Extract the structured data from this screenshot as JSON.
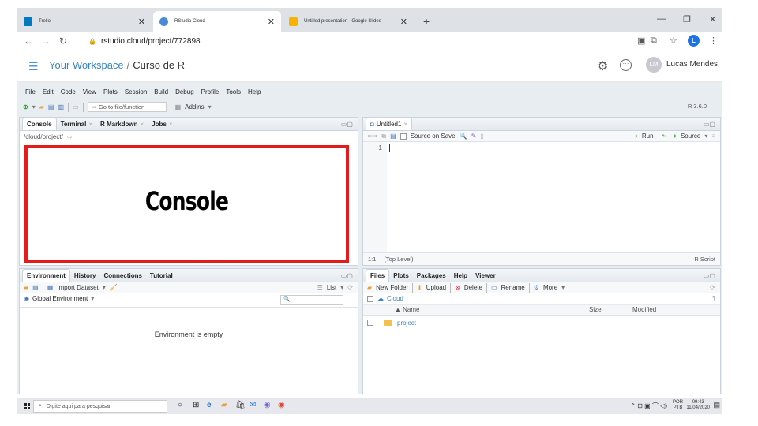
{
  "browser": {
    "tabs": [
      {
        "title": "Trello",
        "close": "✕",
        "favicon_color": "#0079bf"
      },
      {
        "title": "RStudio Cloud",
        "close": "✕",
        "favicon_color": "#4a8bd6"
      },
      {
        "title": "Untitled presentation - Google Slides",
        "close": "✕",
        "favicon_color": "#f4b400"
      }
    ],
    "new_tab": "+",
    "window_controls": {
      "minimize": "—",
      "restore": "❐",
      "close": "✕"
    },
    "url": "rstudio.cloud/project/772898",
    "profile_initial": "L"
  },
  "cloud_header": {
    "workspace": "Your Workspace",
    "separator": "/",
    "project": "Curso de R",
    "user": "Lucas Mendes",
    "avatar_initials": "LM"
  },
  "ide": {
    "menu": [
      "File",
      "Edit",
      "Code",
      "View",
      "Plots",
      "Session",
      "Build",
      "Debug",
      "Profile",
      "Tools",
      "Help"
    ],
    "toolbar": {
      "goto_placeholder": "Go to file/function",
      "addins": "Addins",
      "r_version": "R 3.6.0"
    },
    "console_pane": {
      "tabs": [
        {
          "label": "Console",
          "closable": false
        },
        {
          "label": "Terminal",
          "closable": true
        },
        {
          "label": "R Markdown",
          "closable": true
        },
        {
          "label": "Jobs",
          "closable": true
        }
      ],
      "path": "/cloud/project/",
      "annotation": "Console"
    },
    "editor_pane": {
      "tab": "Untitled1",
      "source_on_save": "Source on Save",
      "run": "Run",
      "source": "Source",
      "line_numbers": [
        "1"
      ],
      "cursor_pos": "1:1",
      "scope": "(Top Level)",
      "filetype": "R Script"
    },
    "env_pane": {
      "tabs": [
        "Environment",
        "History",
        "Connections",
        "Tutorial"
      ],
      "import_dataset": "Import Dataset",
      "list_view": "List",
      "scope": "Global Environment",
      "empty_message": "Environment is empty"
    },
    "files_pane": {
      "tabs": [
        "Files",
        "Plots",
        "Packages",
        "Help",
        "Viewer"
      ],
      "actions": [
        "New Folder",
        "Upload",
        "Delete",
        "Rename",
        "More"
      ],
      "location": "Cloud",
      "columns": [
        "Name",
        "Size",
        "Modified"
      ],
      "rows": [
        {
          "name": "project",
          "size": "",
          "modified": ""
        }
      ]
    }
  },
  "taskbar": {
    "search_placeholder": "Digite aqui para pesquisar",
    "lang": [
      "POR",
      "PTB"
    ],
    "time": "09:43",
    "date": "11/04/2020"
  }
}
